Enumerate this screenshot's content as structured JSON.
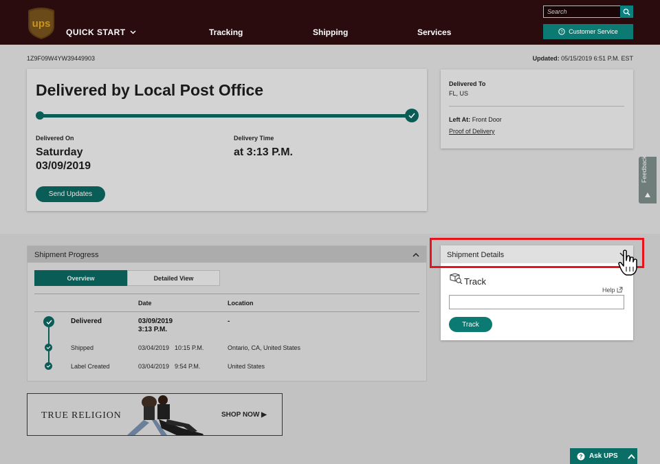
{
  "header": {
    "logo_text": "ups",
    "quick_start": "QUICK START",
    "nav": [
      "Tracking",
      "Shipping",
      "Services"
    ],
    "search_placeholder": "Search",
    "customer_service": "Customer Service"
  },
  "tracking": {
    "number": "1Z9F09W4YW39449903",
    "updated_label": "Updated:",
    "updated_value": "05/15/2019 6:51 P.M. EST",
    "status_title": "Delivered by Local Post Office",
    "delivered_on_label": "Delivered On",
    "delivered_on_day": "Saturday",
    "delivered_on_date": "03/09/2019",
    "delivery_time_label": "Delivery Time",
    "delivery_time_value": "at 3:13 P.M.",
    "send_updates": "Send Updates",
    "progress": 1.0
  },
  "delivered_to": {
    "label": "Delivered To",
    "value": "FL, US",
    "left_at_label": "Left At:",
    "left_at_value": "Front Door",
    "proof_link": "Proof of Delivery"
  },
  "feedback": {
    "label": "Feedback"
  },
  "shipment_progress": {
    "title": "Shipment Progress",
    "tabs": [
      "Overview",
      "Detailed View"
    ],
    "columns": [
      "Date",
      "Location"
    ],
    "rows": [
      {
        "status": "Delivered",
        "date": "03/09/2019",
        "time": "3:13 P.M.",
        "location": "-"
      },
      {
        "status": "Shipped",
        "date": "03/04/2019",
        "time": "10:15 P.M.",
        "location": "Ontario, CA, United States"
      },
      {
        "status": "Label Created",
        "date": "03/04/2019",
        "time": "9:54 P.M.",
        "location": "United States"
      }
    ]
  },
  "ad": {
    "brand": "TRUE RELIGION",
    "cta": "SHOP NOW ▶"
  },
  "shipment_details": {
    "title": "Shipment Details",
    "track_title": "Track",
    "help": "Help",
    "track_button": "Track"
  },
  "ask_ups": "Ask UPS",
  "colors": {
    "brown": "#2a0c0e",
    "teal": "#0a5c57",
    "highlight": "#e8121c",
    "gold": "#c8961e"
  }
}
